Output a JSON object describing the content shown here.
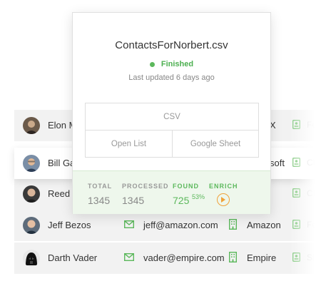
{
  "popup": {
    "file_name": "ContactsForNorbert.csv",
    "status": "Finished",
    "last_updated": "Last updated 6 days ago",
    "buttons": {
      "csv": "CSV",
      "open_list": "Open List",
      "google_sheet": "Google Sheet"
    },
    "stats": {
      "total_label": "TOTAL",
      "total_value": "1345",
      "processed_label": "PROCESSED",
      "processed_value": "1345",
      "found_label": "FOUND",
      "found_value": "725",
      "found_pct": "53%",
      "enrich_label": "ENRICH"
    },
    "colors": {
      "accent_green": "#5cb85c",
      "enrich_orange": "#f0a23a",
      "stats_background": "#eef7ec"
    }
  },
  "contacts": [
    {
      "name": "Elon M",
      "email": "",
      "company": "X",
      "industry": "Fo"
    },
    {
      "name": "Bill Ga",
      "email": "",
      "company": "soft",
      "industry": "Ch"
    },
    {
      "name": "Reed",
      "email": "",
      "company": "",
      "industry": "CE"
    },
    {
      "name": "Jeff Bezos",
      "email": "jeff@amazon.com",
      "company": "Amazon",
      "industry": "Fo"
    },
    {
      "name": "Darth Vader",
      "email": "vader@empire.com",
      "company": "Empire",
      "industry": "Sith"
    }
  ],
  "icons": {
    "email": "envelope-icon",
    "company": "building-icon",
    "contact": "contact-card-icon",
    "status": "status-dot",
    "enrich": "play-circle-icon"
  }
}
